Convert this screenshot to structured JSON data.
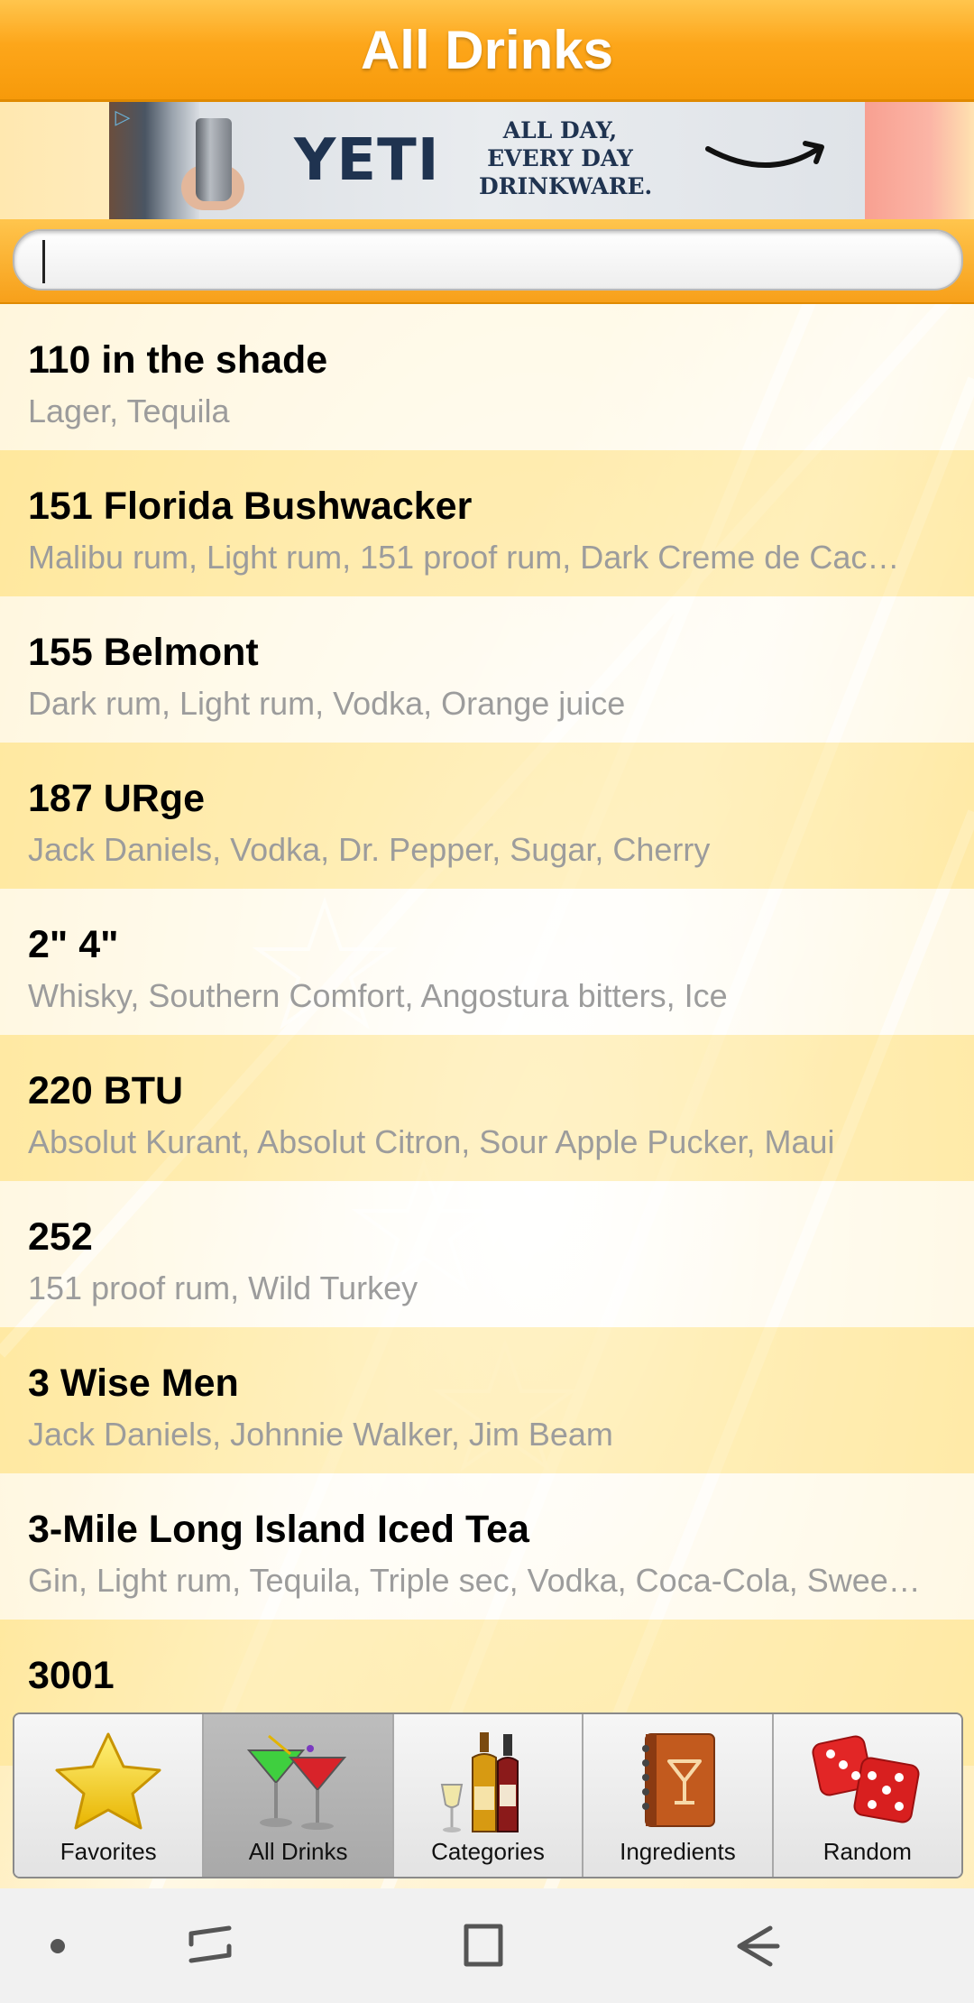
{
  "header": {
    "title": "All Drinks"
  },
  "ad": {
    "brand": "YETI",
    "tagline_lines": [
      "ALL DAY,",
      "EVERY DAY",
      "DRINKWARE."
    ],
    "info_icon": "ad-choices-icon"
  },
  "search": {
    "value": "",
    "placeholder": ""
  },
  "drinks": [
    {
      "name": "110 in the shade",
      "ingredients": "Lager, Tequila"
    },
    {
      "name": "151 Florida Bushwacker",
      "ingredients": "Malibu rum, Light rum, 151 proof rum, Dark Creme de Cac…"
    },
    {
      "name": "155 Belmont",
      "ingredients": "Dark rum, Light rum, Vodka, Orange juice"
    },
    {
      "name": "187 URge",
      "ingredients": "Jack Daniels, Vodka, Dr. Pepper, Sugar, Cherry"
    },
    {
      "name": "2\" 4\"",
      "ingredients": "Whisky, Southern Comfort, Angostura bitters, Ice"
    },
    {
      "name": "220 BTU",
      "ingredients": "Absolut Kurant, Absolut Citron, Sour Apple Pucker, Maui"
    },
    {
      "name": "252",
      "ingredients": "151 proof rum, Wild Turkey"
    },
    {
      "name": "3 Wise Men",
      "ingredients": "Jack Daniels, Johnnie Walker, Jim Beam"
    },
    {
      "name": "3-Mile Long Island Iced Tea",
      "ingredients": "Gin, Light rum, Tequila, Triple sec, Vodka, Coca-Cola, Swee…"
    },
    {
      "name": "3001",
      "ingredients": ""
    }
  ],
  "tabs": [
    {
      "label": "Favorites",
      "icon": "star-icon",
      "active": false
    },
    {
      "label": "All Drinks",
      "icon": "cocktail-glasses-icon",
      "active": true
    },
    {
      "label": "Categories",
      "icon": "liquor-bottles-icon",
      "active": false
    },
    {
      "label": "Ingredients",
      "icon": "recipe-book-icon",
      "active": false
    },
    {
      "label": "Random",
      "icon": "dice-icon",
      "active": false
    }
  ],
  "system_nav": [
    "dot-icon",
    "recents-icon",
    "home-icon",
    "back-icon"
  ],
  "colors": {
    "header": "#fda61a",
    "header_text": "#ffffff",
    "ingredient_text": "#9c9c9c",
    "active_tab": "#b3b3b3"
  }
}
